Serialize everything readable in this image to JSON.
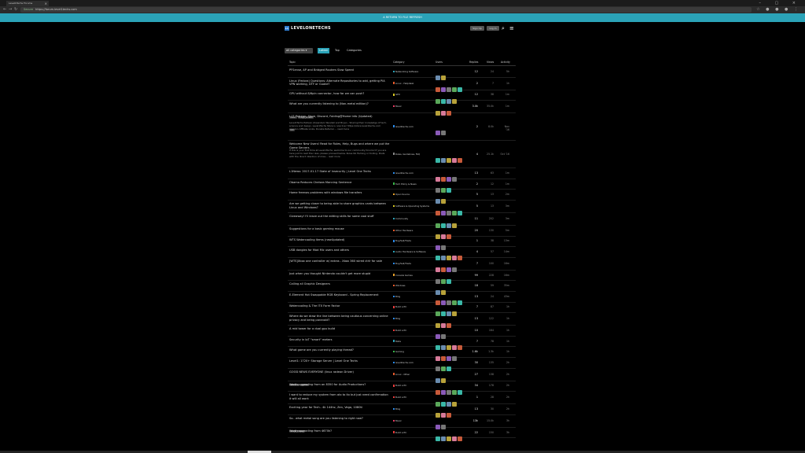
{
  "browser": {
    "tab_title": "Level1Techs Forums",
    "url_secure": "Secure",
    "url": "https://forum.level1techs.com"
  },
  "announcement": "A RETURN TO FILE REFRESH",
  "header": {
    "logo_mark": "L1",
    "logo_text": "LEVELONETECHS",
    "signup": "Sign Up",
    "login": "Log In"
  },
  "nav": {
    "category_select": "all categories ▾",
    "latest": "Latest",
    "top": "Top",
    "categories": "Categories"
  },
  "columns": {
    "topic": "Topic",
    "category": "Category",
    "users": "Users",
    "replies": "Replies",
    "views": "Views",
    "activity": "Activity"
  },
  "colors": {
    "accent": "#2ba3b8",
    "brand": "#2f7dd1"
  },
  "topics": [
    {
      "title": "PFSense, AP and Bridged Routers Slow Speed",
      "category": "Networking Software",
      "cat_color": "#2ba3b8",
      "replies": "12",
      "views": "24",
      "activity": "5h"
    },
    {
      "title": "Linux (Fedora) Questions: Alternate Repositories to add, getting PIA VPN working, DTF or Guake?",
      "category": "Linux - Helpdesk",
      "cat_color": "#e85b2b",
      "replies": "2",
      "views": "7",
      "activity": "1h"
    },
    {
      "title": "GPU without 8/6pin connector, how far we can push?",
      "category": "GPU",
      "cat_color": "#d6c624",
      "replies": "12",
      "views": "38",
      "activity": "1m"
    },
    {
      "title": "What are you currently listening to (Non-metal edition)?",
      "category": "Music",
      "cat_color": "#e83b63",
      "replies": "3.0k",
      "views": "35.0k",
      "activity": "1m",
      "tags": [
        "music",
        "image_thread"
      ]
    },
    {
      "title": "L1T Patreon, Store, Discord, Folding@Home Info (Updated)",
      "category": "level1techs.com",
      "cat_color": "#2b8ae8",
      "replies": "2",
      "views": "8.0k",
      "activity": "Nov '16",
      "tags": [
        "info"
      ],
      "excerpt": "Level1Techs Patreon (Kwendell, Wendell and Bryan - Sharing their knowledge of tech, science and design. Level1Techs Store is now live! https://store.level1techs.com Amazon Affiliate Links, Donate Referral ... read more"
    },
    {
      "title": "Welcome New Users! Read for Rules, Help, Bugs and where we put the Game Servers",
      "category": "Rules, Guidelines, FAQ",
      "cat_color": "#888888",
      "replies": "4",
      "views": "25.1k",
      "activity": "Oct '16",
      "excerpt": "If this is your first time at Level1Techs, welcome to our community forums! If you are here just to read the rules, please proceed below. Rules No flaming or trolling. Posts with the direct intention of miss... read more"
    },
    {
      "title": "L1News: 2017-01-17 State of Insecurity | Level One Techs",
      "category": "level1techs.com",
      "cat_color": "#2b8ae8",
      "replies": "13",
      "views": "63",
      "activity": "1m"
    },
    {
      "title": "Obama Reduces Chelsea Manning Sentence",
      "category": "Tech Policy & News",
      "cat_color": "#3ab54a",
      "replies": "2",
      "views": "12",
      "activity": "1m"
    },
    {
      "title": "Home freenas problems with windows file transfers",
      "category": "Open Source",
      "cat_color": "#e8a22b",
      "replies": "5",
      "views": "13",
      "activity": "2m"
    },
    {
      "title": "Are we getting closer to being able to share graphics cards between Linux and Windows?",
      "category": "Software & Operating Systems",
      "cat_color": "#d6c624",
      "replies": "5",
      "views": "13",
      "activity": "3m"
    },
    {
      "title": "Giveaway! I'll leave out the editing skills for some cool stuff",
      "category": "Community",
      "cat_color": "#2ba3b8",
      "replies": "11",
      "views": "202",
      "activity": "3m"
    },
    {
      "title": "Suggestions for a basic gaming mouse",
      "category": "Other Hardware",
      "cat_color": "#e85b2b",
      "replies": "20",
      "views": "130",
      "activity": "5m"
    },
    {
      "title": "WTS Watercooling items (newUpdated)",
      "category": "Buy/Sell/Trade",
      "cat_color": "#2b8ae8",
      "replies": "1",
      "views": "38",
      "activity": "13m"
    },
    {
      "title": "USB dongles for Mod Mic users and others",
      "category": "Audio Hardware & Software",
      "cat_color": "#2ba3b8",
      "replies": "4",
      "views": "57",
      "activity": "14m"
    },
    {
      "title": "[WTS]Xbox one controller w/ extras - Xbox 360 wired ctrlr for sale",
      "category": "Buy/Sell/Trade",
      "cat_color": "#2b8ae8",
      "replies": "7",
      "views": "100",
      "activity": "16m"
    },
    {
      "title": "Just when you thought Nintendo couldn't get more stupid",
      "category": "Console Games",
      "cat_color": "#e8a22b",
      "replies": "99",
      "views": "228",
      "activity": "16m"
    },
    {
      "title": "Calling all Graphic Designers",
      "category": "Windows",
      "cat_color": "#e85b2b",
      "replies": "18",
      "views": "59",
      "activity": "35m"
    },
    {
      "title": "E-Element Hot Swappable RGB Keyboard - Spring Replacement",
      "category": "Blog",
      "cat_color": "#2b8ae8",
      "replies": "13",
      "views": "24",
      "activity": "43m"
    },
    {
      "title": "Watercooling & The ITX Form Factor",
      "category": "Build a PC",
      "cat_color": "#e83b3b",
      "replies": "7",
      "views": "87",
      "activity": "1h"
    },
    {
      "title": "Where do we draw the line between being cautious concerning online privacy and being paranoid?",
      "category": "Blog",
      "cat_color": "#2b8ae8",
      "replies": "13",
      "views": "122",
      "activity": "1h"
    },
    {
      "title": "A mid tower for a dual gpu build",
      "category": "Build a PC",
      "cat_color": "#e83b3b",
      "replies": "10",
      "views": "164",
      "activity": "1h"
    },
    {
      "title": "Security in IoT \"smart\" meters",
      "category": "Meta",
      "cat_color": "#2ba3b8",
      "replies": "7",
      "views": "78",
      "activity": "1h"
    },
    {
      "title": "What game are you currently playing thread?",
      "category": "Gaming",
      "cat_color": "#3ab54a",
      "replies": "1.6k",
      "views": "1.3k",
      "activity": "1h"
    },
    {
      "title": "Level1: 1720+ Storage Server | Level One Techs",
      "category": "level1techs.com",
      "cat_color": "#2b8ae8",
      "replies": "30",
      "views": "135",
      "activity": "2h"
    },
    {
      "title": "GOOD NEWS EVERYONE (linux radeon Driver)",
      "category": "Linux - Other",
      "cat_color": "#e85b2b",
      "replies": "27",
      "views": "138",
      "activity": "2h",
      "tags": [
        "radeonsi",
        "games"
      ]
    },
    {
      "title": "Worth upgrading from an 8350 for Audio Productions?",
      "category": "Build a PC",
      "cat_color": "#e83b3b",
      "replies": "34",
      "views": "178",
      "activity": "2h"
    },
    {
      "title": "I want to reduce my system from atx to itx but just need confirmation it will all work",
      "category": "Build a PC",
      "cat_color": "#e83b3b",
      "replies": "1",
      "views": "28",
      "activity": "2h"
    },
    {
      "title": "Exciting year for Tech.. 4k 144hz, Zen, Vega, 1080ti",
      "category": "Blog",
      "cat_color": "#2b8ae8",
      "replies": "13",
      "views": "30",
      "activity": "2h"
    },
    {
      "title": "So.. what metal song are you listening to right now?",
      "category": "Music",
      "cat_color": "#e83b63",
      "replies": "13k",
      "views": "15.0k",
      "activity": "3h",
      "tags": [
        "image_thread"
      ]
    },
    {
      "title": "Worth upgrading from 4670k?",
      "category": "Build a PC",
      "cat_color": "#e83b3b",
      "replies": "22",
      "views": "150",
      "activity": "3h"
    }
  ]
}
